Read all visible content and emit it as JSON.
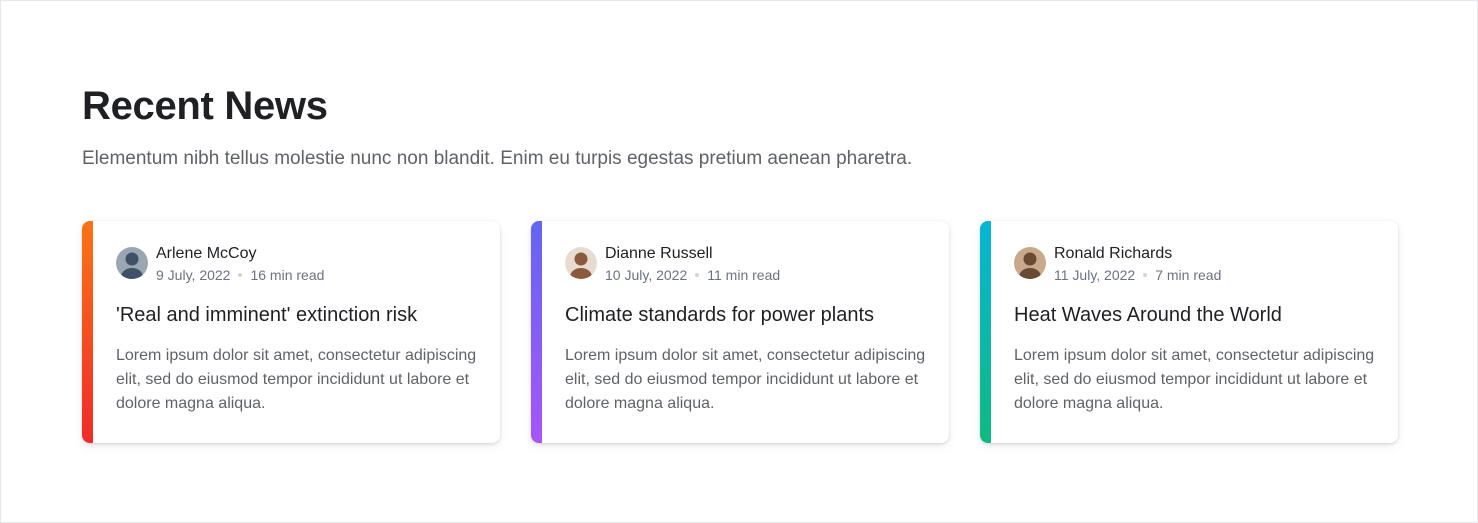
{
  "section": {
    "title": "Recent News",
    "subtitle": "Elementum nibh tellus molestie nunc non blandit. Enim eu turpis egestas pretium aenean pharetra."
  },
  "cards": [
    {
      "author": "Arlene McCoy",
      "date": "9 July, 2022",
      "read_time": "16 min read",
      "title": "'Real and imminent' extinction risk",
      "excerpt": "Lorem ipsum dolor sit amet, consectetur adipiscing elit, sed do eiusmod tempor incididunt ut labore et dolore magna aliqua.",
      "accent_from": "#f97316",
      "accent_to": "#ef2b2b",
      "avatar_bg": "#9aa7b3",
      "avatar_fg": "#3f5166"
    },
    {
      "author": "Dianne Russell",
      "date": "10 July, 2022",
      "read_time": "11 min read",
      "title": "Climate standards for power plants",
      "excerpt": "Lorem ipsum dolor sit amet, consectetur adipiscing elit, sed do eiusmod tempor incididunt ut labore et dolore magna aliqua.",
      "accent_from": "#6366f1",
      "accent_to": "#a855f7",
      "avatar_bg": "#e7dcd2",
      "avatar_fg": "#8b5a3c"
    },
    {
      "author": "Ronald Richards",
      "date": "11 July, 2022",
      "read_time": "7 min read",
      "title": "Heat Waves Around the World",
      "excerpt": "Lorem ipsum dolor sit amet, consectetur adipiscing elit, sed do eiusmod tempor incididunt ut labore et dolore magna aliqua.",
      "accent_from": "#06b6d4",
      "accent_to": "#10b981",
      "avatar_bg": "#c9a98c",
      "avatar_fg": "#6b4a33"
    }
  ]
}
